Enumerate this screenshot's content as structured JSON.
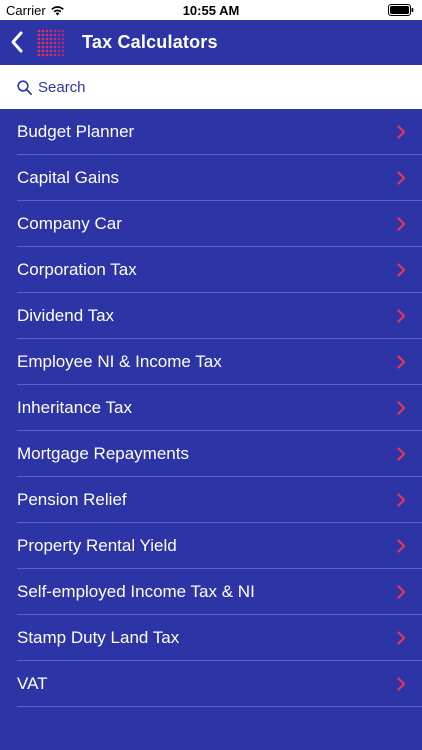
{
  "status_bar": {
    "carrier": "Carrier",
    "time": "10:55 AM"
  },
  "nav": {
    "title": "Tax Calculators"
  },
  "search": {
    "placeholder": "Search"
  },
  "colors": {
    "background": "#2d35a6",
    "chevron": "#e8345a",
    "text": "#ffffff"
  },
  "calculators": [
    {
      "label": "Budget Planner"
    },
    {
      "label": "Capital Gains"
    },
    {
      "label": "Company Car"
    },
    {
      "label": "Corporation Tax"
    },
    {
      "label": "Dividend Tax"
    },
    {
      "label": "Employee NI & Income Tax"
    },
    {
      "label": "Inheritance Tax"
    },
    {
      "label": "Mortgage Repayments"
    },
    {
      "label": "Pension Relief"
    },
    {
      "label": "Property Rental Yield"
    },
    {
      "label": "Self-employed Income Tax & NI"
    },
    {
      "label": "Stamp Duty Land Tax"
    },
    {
      "label": "VAT"
    }
  ]
}
